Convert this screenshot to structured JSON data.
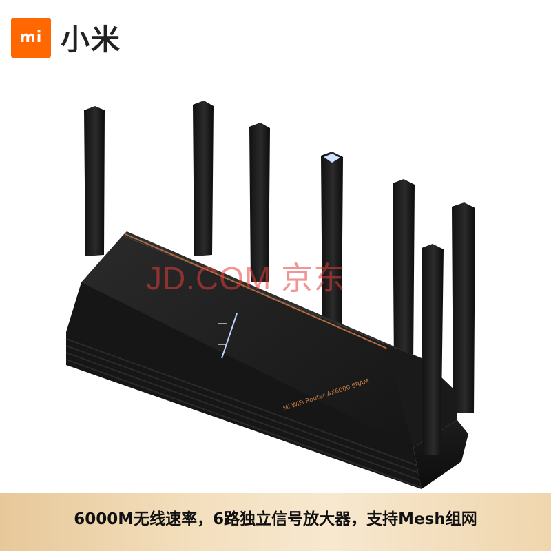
{
  "brand": {
    "logo_mark": "mi",
    "name": "小米",
    "color": "#ff6700"
  },
  "product": {
    "label": "Mi WiFi Router AX6000 6RAM",
    "status_icon": "mesh-light-indicator"
  },
  "watermark": "JD.COM 京东",
  "banner": {
    "text": "6000M无线速率，6路独立信号放大器，支持Mesh组网",
    "color": "#f3dfbd"
  }
}
